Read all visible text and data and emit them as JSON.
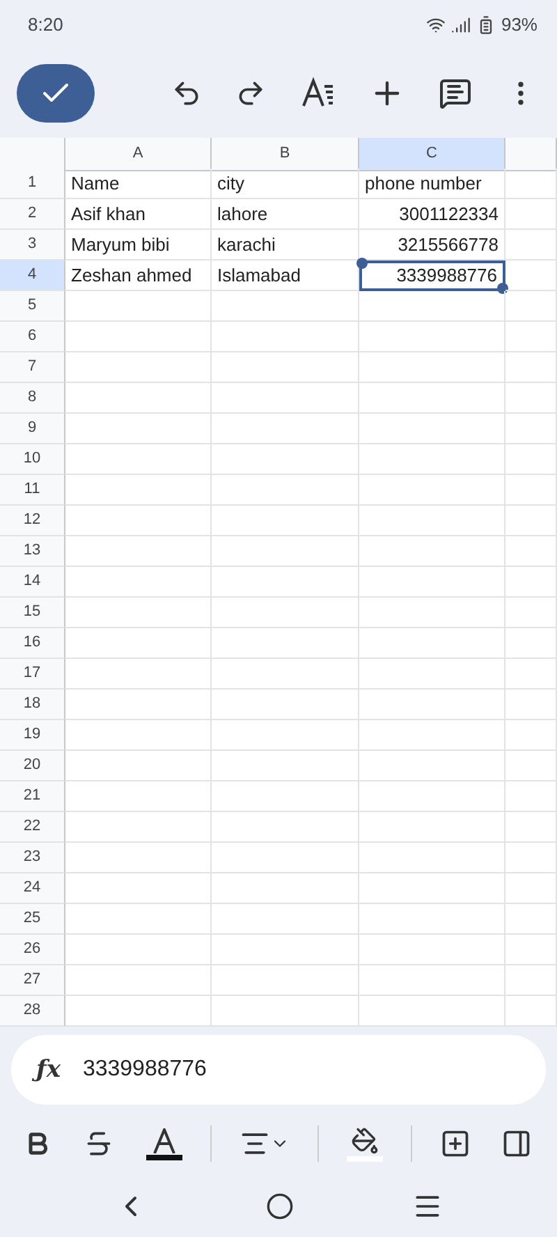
{
  "status_bar": {
    "time": "8:20",
    "battery": "93%"
  },
  "sheet": {
    "columns": [
      {
        "label": "A",
        "selected": false
      },
      {
        "label": "B",
        "selected": false
      },
      {
        "label": "C",
        "selected": true
      }
    ],
    "rows": [
      {
        "label": "1",
        "selected": false,
        "cells": [
          {
            "text": "Name",
            "kind": "text",
            "selected": false
          },
          {
            "text": "city",
            "kind": "text",
            "selected": false
          },
          {
            "text": "phone number",
            "kind": "text",
            "selected": false
          }
        ]
      },
      {
        "label": "2",
        "selected": false,
        "cells": [
          {
            "text": "Asif khan",
            "kind": "text",
            "selected": false
          },
          {
            "text": "lahore",
            "kind": "text",
            "selected": false
          },
          {
            "text": "3001122334",
            "kind": "number",
            "selected": false
          }
        ]
      },
      {
        "label": "3",
        "selected": false,
        "cells": [
          {
            "text": "Maryum bibi",
            "kind": "text",
            "selected": false
          },
          {
            "text": "karachi",
            "kind": "text",
            "selected": false
          },
          {
            "text": "3215566778",
            "kind": "number",
            "selected": false
          }
        ]
      },
      {
        "label": "4",
        "selected": true,
        "cells": [
          {
            "text": "Zeshan ahmed",
            "kind": "text",
            "selected": false
          },
          {
            "text": "Islamabad",
            "kind": "text",
            "selected": false
          },
          {
            "text": "3339988776",
            "kind": "number",
            "selected": true
          }
        ]
      },
      {
        "label": "5",
        "selected": false
      },
      {
        "label": "6",
        "selected": false
      },
      {
        "label": "7",
        "selected": false
      },
      {
        "label": "8",
        "selected": false
      },
      {
        "label": "9",
        "selected": false
      },
      {
        "label": "10",
        "selected": false
      },
      {
        "label": "11",
        "selected": false
      },
      {
        "label": "12",
        "selected": false
      },
      {
        "label": "13",
        "selected": false
      },
      {
        "label": "14",
        "selected": false
      },
      {
        "label": "15",
        "selected": false
      },
      {
        "label": "16",
        "selected": false
      },
      {
        "label": "17",
        "selected": false
      },
      {
        "label": "18",
        "selected": false
      },
      {
        "label": "19",
        "selected": false
      },
      {
        "label": "20",
        "selected": false
      },
      {
        "label": "21",
        "selected": false
      },
      {
        "label": "22",
        "selected": false
      },
      {
        "label": "23",
        "selected": false
      },
      {
        "label": "24",
        "selected": false
      },
      {
        "label": "25",
        "selected": false
      },
      {
        "label": "26",
        "selected": false
      },
      {
        "label": "27",
        "selected": false
      },
      {
        "label": "28",
        "selected": false
      }
    ]
  },
  "formula_bar": {
    "icon": "ƒx",
    "value": "3339988776"
  }
}
